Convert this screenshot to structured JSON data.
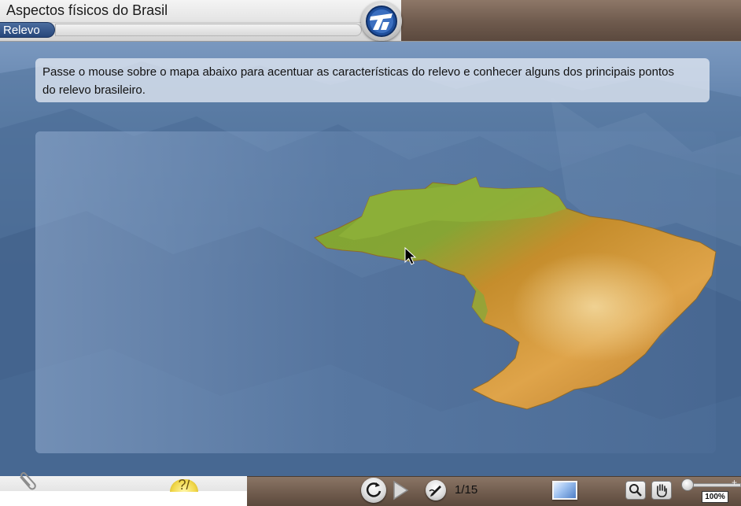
{
  "header": {
    "title": "Aspectos físicos do Brasil",
    "section_label": "Relevo"
  },
  "instruction": {
    "text": "Passe o mouse sobre o mapa abaixo para acentuar as características do relevo e conhecer alguns dos principais pontos do relevo brasileiro."
  },
  "map": {
    "subject": "Brasil relief map"
  },
  "controls": {
    "help_glyph": "?/",
    "page_indicator": "1/15",
    "zoom_level": "100%",
    "zoom_plus": "+"
  },
  "icons": [
    "logo-icon",
    "paperclip-icon",
    "help-icon",
    "replay-icon",
    "play-icon",
    "notes-icon",
    "fullscreen-icon",
    "zoom-icon",
    "hand-icon"
  ],
  "colors": {
    "section_pill": "#27467a",
    "header_bg": "#e6e6e6",
    "bottom_bar": "#6d594b",
    "lowland_green": "#7ea632",
    "highland_orange": "#d6922e"
  }
}
